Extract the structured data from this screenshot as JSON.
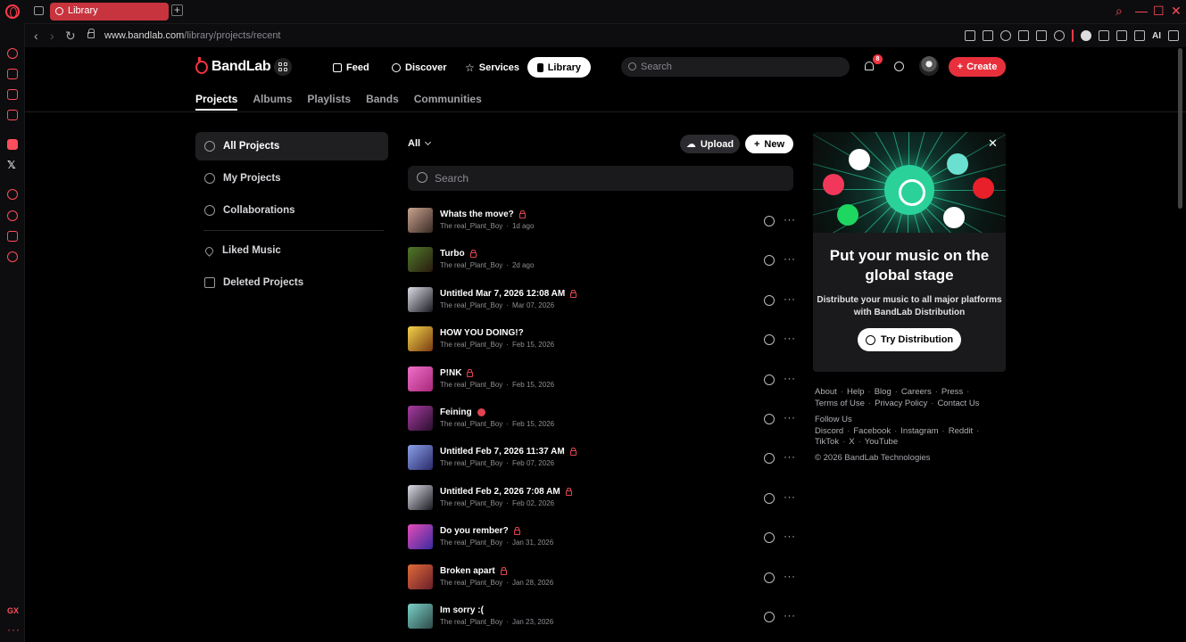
{
  "browser": {
    "tab_title": "Library",
    "new_tab": "+",
    "url_domain": "www.bandlab.com",
    "url_path": "/library/projects/recent",
    "ai_label": "AI",
    "sidebar_gx": "GX",
    "sidebar_more": "···"
  },
  "header": {
    "logo_text": "BandLab",
    "nav": [
      {
        "label": "Feed",
        "icon": "home-icon"
      },
      {
        "label": "Discover",
        "icon": "compass-icon"
      },
      {
        "label": "Services",
        "icon": "star-icon"
      },
      {
        "label": "Library",
        "icon": "library-icon",
        "active": true
      }
    ],
    "search_placeholder": "Search",
    "notification_count": "8",
    "create_label": "Create"
  },
  "subnav": {
    "tabs": [
      "Projects",
      "Albums",
      "Playlists",
      "Bands",
      "Communities"
    ],
    "active": "Projects"
  },
  "left_panel": {
    "items": [
      {
        "label": "All Projects",
        "active": true
      },
      {
        "label": "My Projects"
      },
      {
        "label": "Collaborations"
      },
      {
        "label": "Liked Music"
      },
      {
        "label": "Deleted Projects"
      }
    ]
  },
  "projects": {
    "filter_label": "All",
    "upload_label": "Upload",
    "new_label": "New",
    "search_placeholder": "Search",
    "rows": [
      {
        "title": "Whats the move?",
        "owner": "The real_Plant_Boy",
        "date": "1d ago",
        "badge": "lock",
        "thumb": [
          "#c8a38f",
          "#3a2a25"
        ]
      },
      {
        "title": "Turbo",
        "owner": "The real_Plant_Boy",
        "date": "2d ago",
        "badge": "lock",
        "thumb": [
          "#4f7a2a",
          "#2a1a10"
        ]
      },
      {
        "title": "Untitled Mar 7, 2026 12:08 AM",
        "owner": "The real_Plant_Boy",
        "date": "Mar 07, 2026",
        "badge": "lock",
        "thumb": [
          "#dcdce6",
          "#1a1a22"
        ]
      },
      {
        "title": "HOW YOU DOING!?",
        "owner": "The real_Plant_Boy",
        "date": "Feb 15, 2026",
        "badge": "none",
        "thumb": [
          "#f2d34a",
          "#7a3b12"
        ]
      },
      {
        "title": "P!NK",
        "owner": "The real_Plant_Boy",
        "date": "Feb 15, 2026",
        "badge": "lock",
        "thumb": [
          "#ee6fc8",
          "#a8287a"
        ]
      },
      {
        "title": "Feining",
        "owner": "The real_Plant_Boy",
        "date": "Feb 15, 2026",
        "badge": "heart",
        "thumb": [
          "#a63ca0",
          "#2a0e2e"
        ]
      },
      {
        "title": "Untitled Feb 7, 2026 11:37 AM",
        "owner": "The real_Plant_Boy",
        "date": "Feb 07, 2026",
        "badge": "lock",
        "thumb": [
          "#8aa0e8",
          "#2a2a6a"
        ]
      },
      {
        "title": "Untitled Feb 2, 2026 7:08 AM",
        "owner": "The real_Plant_Boy",
        "date": "Feb 02, 2026",
        "badge": "lock",
        "thumb": [
          "#dcdce6",
          "#1a1a22"
        ]
      },
      {
        "title": "Do you rember?",
        "owner": "The real_Plant_Boy",
        "date": "Jan 31, 2026",
        "badge": "lock",
        "thumb": [
          "#e64cb8",
          "#3a2aa0"
        ]
      },
      {
        "title": "Broken apart",
        "owner": "The real_Plant_Boy",
        "date": "Jan 28, 2026",
        "badge": "lock",
        "thumb": [
          "#e06a3a",
          "#6a1e2a"
        ]
      },
      {
        "title": "Im sorry :(",
        "owner": "The real_Plant_Boy",
        "date": "Jan 23, 2026",
        "badge": "none",
        "thumb": [
          "#7ad0c8",
          "#2e4a48"
        ]
      }
    ]
  },
  "promo": {
    "title": "Put your music on the global stage",
    "description": "Distribute your music to all major platforms with BandLab Distribution",
    "button_label": "Try Distribution",
    "close_label": "✕"
  },
  "footer": {
    "links_1": [
      "About",
      "Help",
      "Blog",
      "Careers",
      "Press"
    ],
    "links_2": [
      "Terms of Use",
      "Privacy Policy",
      "Contact Us"
    ],
    "follow_heading": "Follow Us",
    "social_1": [
      "Discord",
      "Facebook",
      "Instagram",
      "Reddit"
    ],
    "social_2": [
      "TikTok",
      "X",
      "YouTube"
    ],
    "copyright": "© 2026 BandLab Technologies"
  },
  "colors": {
    "accent_red": "#e8303c",
    "distribution_green": "#2ad29a"
  }
}
